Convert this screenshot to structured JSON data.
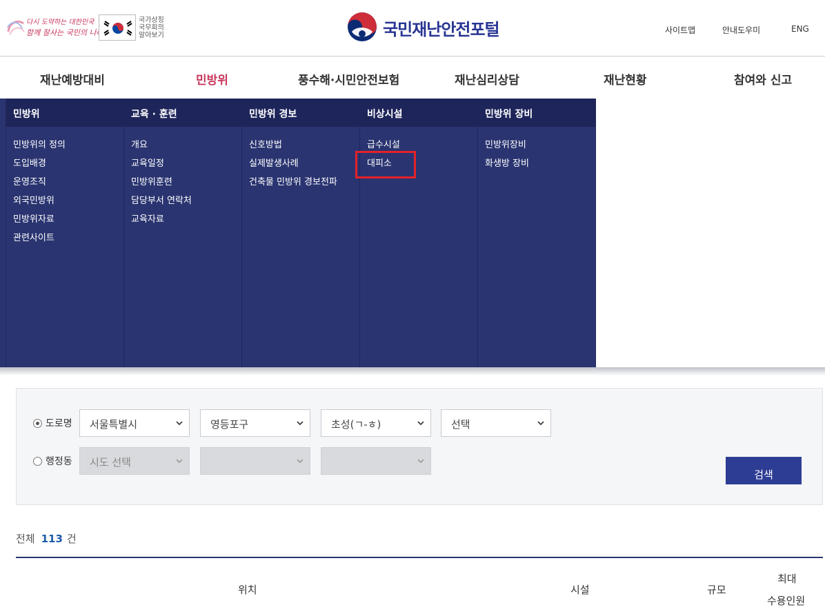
{
  "header": {
    "slogan_line1": "다시 도약하는 대한민국",
    "slogan_line2": "함께 잘사는 국민의 나라",
    "flag_text": [
      "국가상징",
      "국무회의",
      "알아보기"
    ],
    "logo_text": "국민재난안전포털",
    "util_links": [
      "사이트맵",
      "안내도우미",
      "ENG"
    ]
  },
  "gnb": {
    "items": [
      "재난예방대비",
      "민방위",
      "풍수해·시민안전보험",
      "재난심리상담",
      "재난현황",
      "참여와 신고"
    ],
    "active_index": 1
  },
  "mega_menu": {
    "columns": [
      {
        "title": "민방위",
        "items": [
          "민방위의 정의",
          "도입배경",
          "운영조직",
          "외국민방위",
          "민방위자료",
          "관련사이트"
        ]
      },
      {
        "title": "교육 · 훈련",
        "items": [
          "개요",
          "교육일정",
          "민방위훈련",
          "담당부서 연락처",
          "교육자료"
        ]
      },
      {
        "title": "민방위 경보",
        "items": [
          "신호방법",
          "실제발생사례",
          "건축물 민방위 경보전파"
        ]
      },
      {
        "title": "비상시설",
        "items": [
          "급수시설",
          "대피소"
        ]
      },
      {
        "title": "민방위 장비",
        "items": [
          "민방위장비",
          "화생방 장비"
        ]
      }
    ]
  },
  "search": {
    "road_label": "도로명",
    "admin_label": "행정동",
    "road_selects": [
      "서울특별시",
      "영등포구",
      "초성(ㄱ-ㅎ)",
      "선택"
    ],
    "admin_selects": [
      "시도 선택",
      "",
      ""
    ],
    "button": "검색"
  },
  "results": {
    "total_label": "전체",
    "total_count": "113",
    "unit": "건",
    "columns": [
      "위치",
      "시설",
      "규모",
      "최대",
      "수용인원"
    ]
  },
  "colors": {
    "brand": "#2a3470",
    "active": "#c8375c",
    "highlight": "#e52128",
    "button": "#2e3d94"
  }
}
